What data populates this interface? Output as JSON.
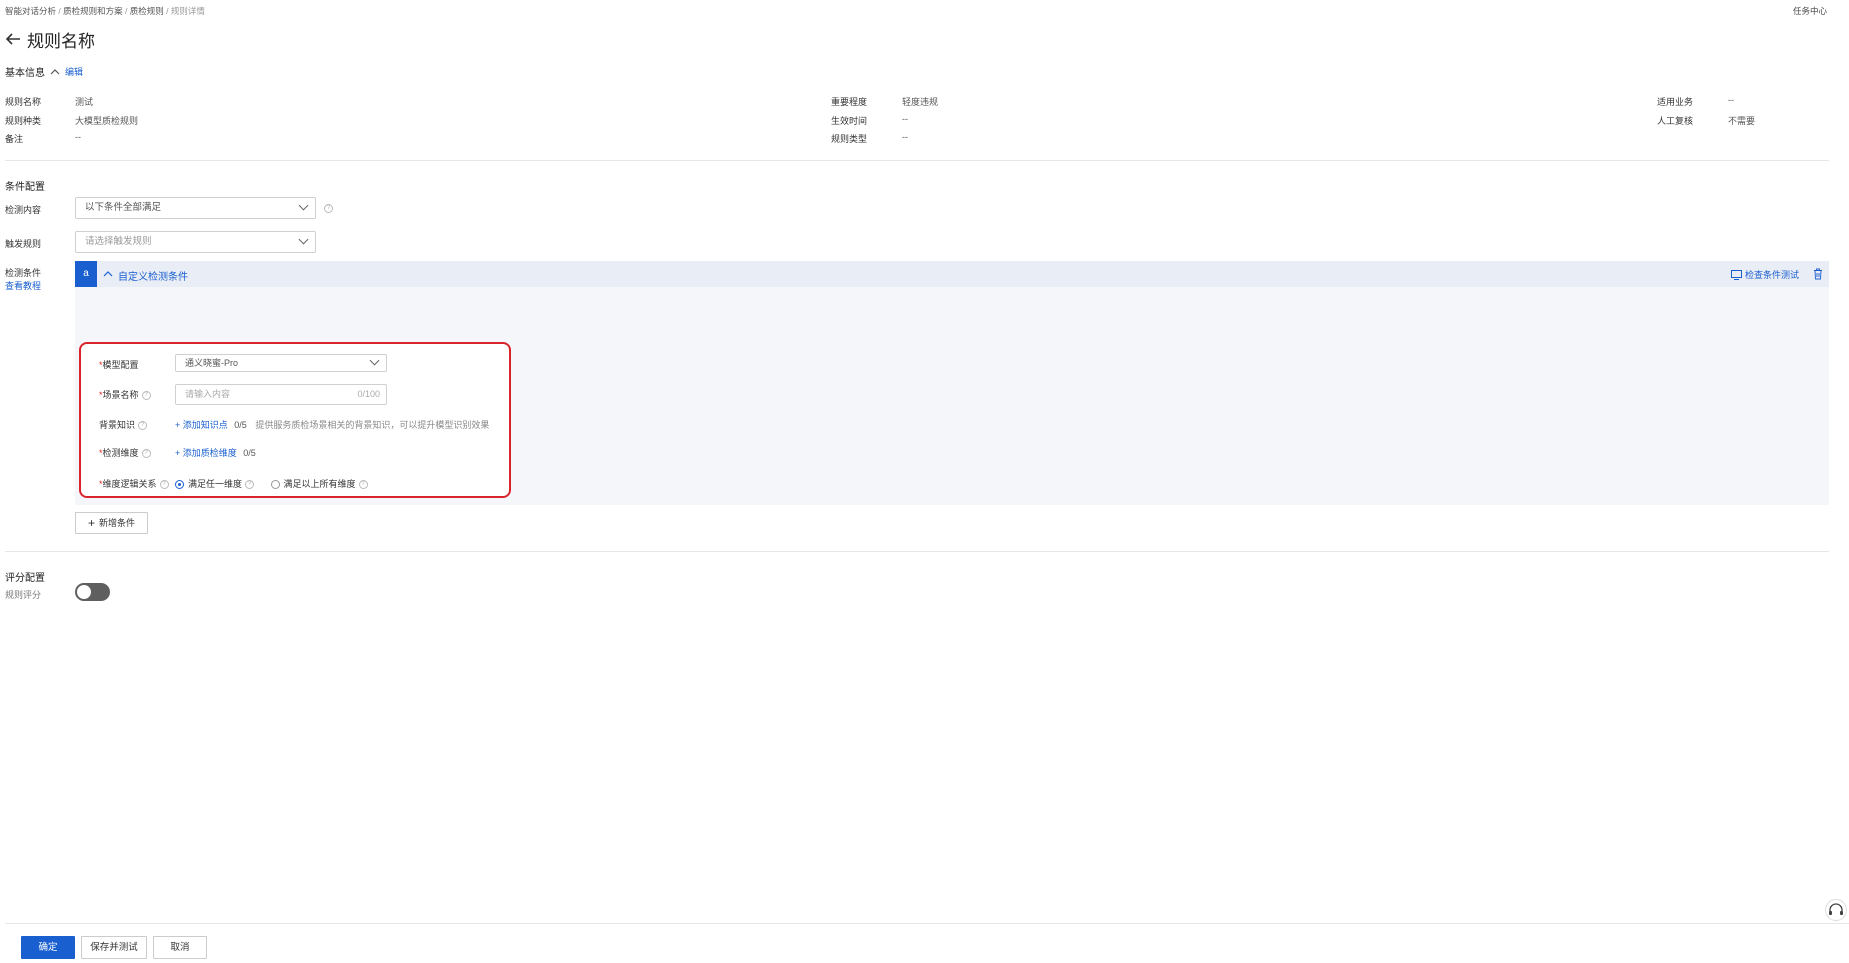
{
  "breadcrumb": [
    "智能对话分析",
    "质检规则和方案",
    "质检规则",
    "规则详情"
  ],
  "task_center": "任务中心",
  "page_title": "规则名称",
  "basic_info": {
    "title": "基本信息",
    "edit": "编辑",
    "rows": [
      {
        "label": "规则名称",
        "value": "测试"
      },
      {
        "label": "规则种类",
        "value": "大模型质检规则"
      },
      {
        "label": "备注",
        "value": "--"
      },
      {
        "label": "重要程度",
        "value": "轻度违规"
      },
      {
        "label": "生效时间",
        "value": "--"
      },
      {
        "label": "规则类型",
        "value": "--"
      },
      {
        "label": "适用业务",
        "value": "--"
      },
      {
        "label": "人工复核",
        "value": "不需要"
      }
    ]
  },
  "condition_config": {
    "title": "条件配置",
    "detect_content_label": "检测内容",
    "detect_content_value": "以下条件全部满足",
    "trigger_label": "触发规则",
    "trigger_placeholder": "请选择触发规则",
    "conditions_label": "检测条件",
    "tutorial_link": "查看教程",
    "condition_badge": "a",
    "condition_title": "自定义检测条件",
    "test_button": "检查条件测试",
    "model_label": "模型配置",
    "model_value": "通义晓蜜-Pro",
    "scene_label": "场景名称",
    "scene_placeholder": "请输入内容",
    "scene_counter": "0/100",
    "knowledge_label": "背景知识",
    "knowledge_add": "+ 添加知识点",
    "knowledge_count": "0/5",
    "knowledge_hint": "提供服务质检场景相关的背景知识，可以提升模型识别效果",
    "dimension_label": "检测维度",
    "dimension_add": "+ 添加质检维度",
    "dimension_count": "0/5",
    "logic_label": "维度逻辑关系",
    "logic_option_any": "满足任一维度",
    "logic_option_all": "满足以上所有维度",
    "add_condition": "新增条件"
  },
  "score_config": {
    "title": "评分配置",
    "rule_score_label": "规则评分",
    "rule_score_enabled": false
  },
  "footer": {
    "confirm": "确定",
    "save_test": "保存并测试",
    "cancel": "取消"
  },
  "colors": {
    "primary": "#1a5fd0",
    "highlight_border": "#d9242b",
    "condition_bg": "#f4f6fa"
  }
}
